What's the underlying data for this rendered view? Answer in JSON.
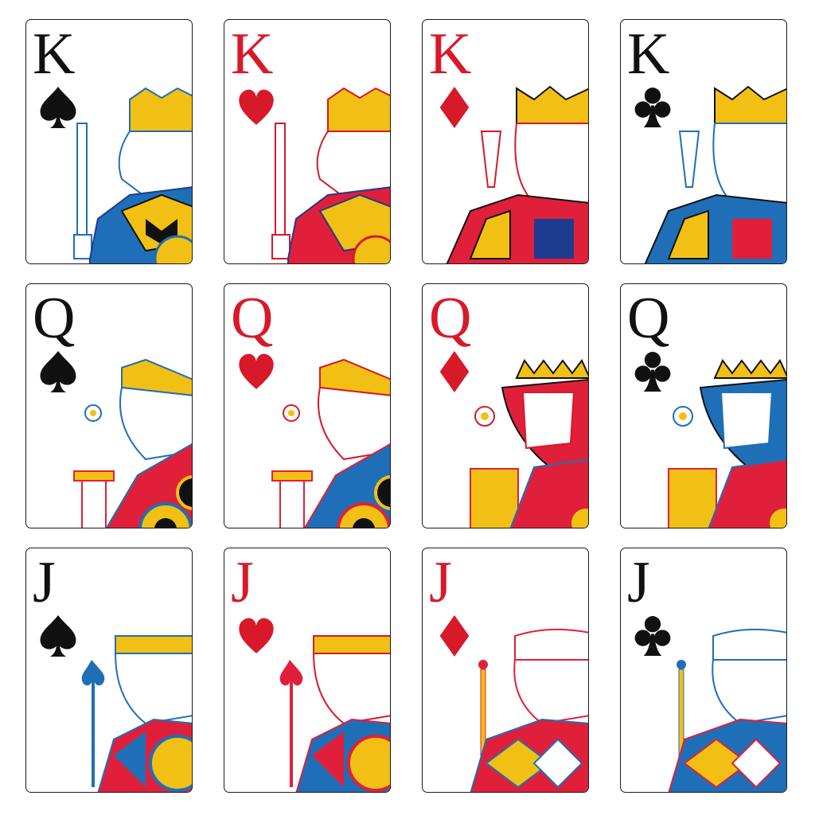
{
  "colors": {
    "red": "#d7192a",
    "black": "#111111",
    "blue": "#1f6fb8",
    "yellow": "#f2c014",
    "crimson": "#e0203a",
    "navy": "#1d3c8f"
  },
  "cards": [
    {
      "rank": "K",
      "suit": "spade",
      "color": "black"
    },
    {
      "rank": "K",
      "suit": "heart",
      "color": "red"
    },
    {
      "rank": "K",
      "suit": "diamond",
      "color": "red"
    },
    {
      "rank": "K",
      "suit": "club",
      "color": "black"
    },
    {
      "rank": "Q",
      "suit": "spade",
      "color": "black"
    },
    {
      "rank": "Q",
      "suit": "heart",
      "color": "red"
    },
    {
      "rank": "Q",
      "suit": "diamond",
      "color": "red"
    },
    {
      "rank": "Q",
      "suit": "club",
      "color": "black"
    },
    {
      "rank": "J",
      "suit": "spade",
      "color": "black"
    },
    {
      "rank": "J",
      "suit": "heart",
      "color": "red"
    },
    {
      "rank": "J",
      "suit": "diamond",
      "color": "red"
    },
    {
      "rank": "J",
      "suit": "club",
      "color": "black"
    }
  ]
}
